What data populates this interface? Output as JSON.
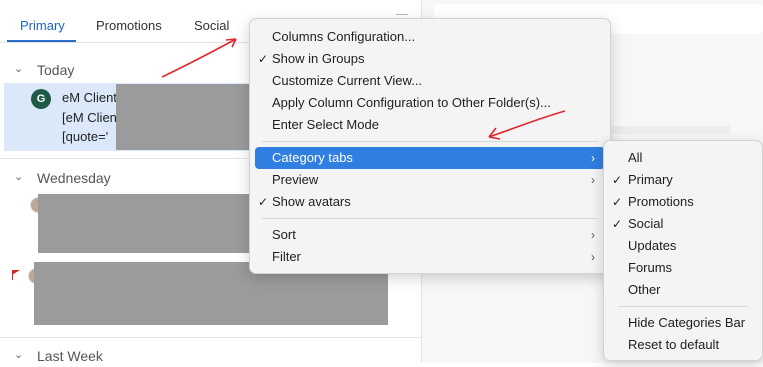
{
  "tabs": {
    "primary": "Primary",
    "promotions": "Promotions",
    "social": "Social"
  },
  "groups": {
    "today": "Today",
    "wednesday": "Wednesday",
    "last_week": "Last Week"
  },
  "selected_mail": {
    "avatar_letter": "G",
    "line1": "eM Client",
    "line2": "[eM Clien",
    "line3": "[quote='"
  },
  "context_menu": {
    "items": [
      {
        "label": "Columns Configuration...",
        "checked": false,
        "submenu": false
      },
      {
        "label": "Show in Groups",
        "checked": true,
        "submenu": false
      },
      {
        "label": "Customize Current View...",
        "checked": false,
        "submenu": false
      },
      {
        "label": "Apply Column Configuration to Other Folder(s)...",
        "checked": false,
        "submenu": false
      },
      {
        "label": "Enter Select Mode",
        "checked": false,
        "submenu": false
      },
      {
        "label": "Category tabs",
        "checked": false,
        "submenu": true,
        "highlighted": true
      },
      {
        "label": "Preview",
        "checked": false,
        "submenu": true
      },
      {
        "label": "Show avatars",
        "checked": true,
        "submenu": false
      },
      {
        "label": "Sort",
        "checked": false,
        "submenu": true
      },
      {
        "label": "Filter",
        "checked": false,
        "submenu": true
      }
    ]
  },
  "category_submenu": {
    "items": [
      {
        "label": "All",
        "checked": false
      },
      {
        "label": "Primary",
        "checked": true
      },
      {
        "label": "Promotions",
        "checked": true
      },
      {
        "label": "Social",
        "checked": true
      },
      {
        "label": "Updates",
        "checked": false
      },
      {
        "label": "Forums",
        "checked": false
      },
      {
        "label": "Other",
        "checked": false
      },
      {
        "label": "Hide Categories Bar",
        "checked": false
      },
      {
        "label": "Reset to default",
        "checked": false
      }
    ]
  },
  "glyphs": {
    "check": "✓",
    "arrow": "›",
    "chevron": "⌄"
  },
  "colors": {
    "accent": "#2f7ee0",
    "selected_row": "#dbe8fa",
    "avatar": "#1f5a46",
    "annotation": "#e0262e"
  }
}
